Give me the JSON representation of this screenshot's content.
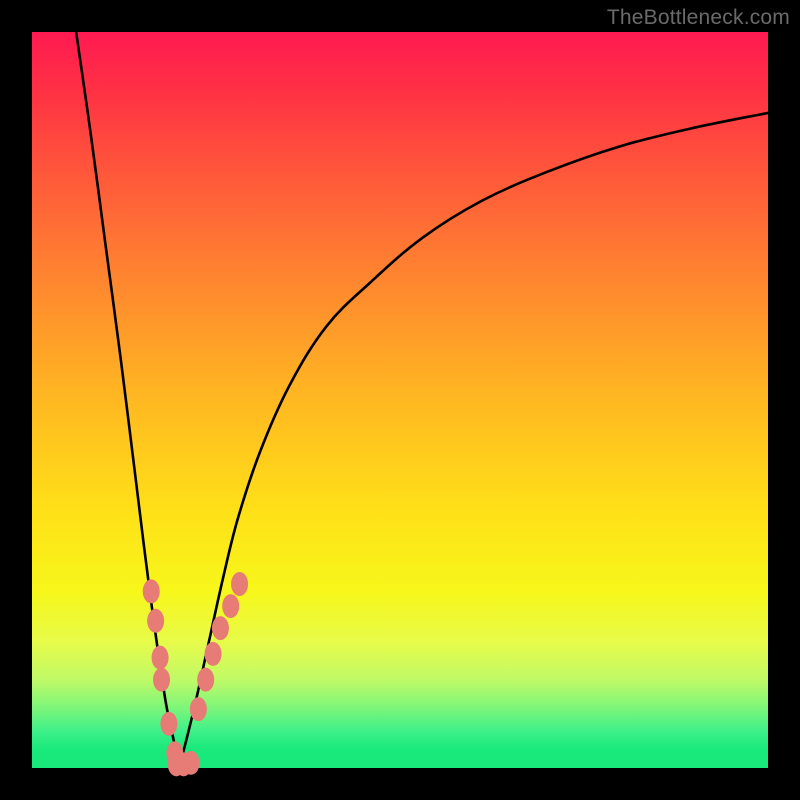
{
  "watermark": "TheBottleneck.com",
  "chart_data": {
    "type": "line",
    "title": "",
    "xlabel": "",
    "ylabel": "",
    "xlim": [
      0,
      100
    ],
    "ylim": [
      0,
      100
    ],
    "grid": false,
    "legend": false,
    "series": [
      {
        "name": "curve-left",
        "x": [
          6,
          8,
          10,
          12,
          14,
          16,
          18,
          19,
          20
        ],
        "y": [
          100,
          86,
          71,
          56,
          40,
          24,
          10,
          5,
          0
        ]
      },
      {
        "name": "curve-right",
        "x": [
          20,
          22,
          24,
          26,
          28,
          31,
          35,
          40,
          46,
          53,
          61,
          70,
          80,
          90,
          100
        ],
        "y": [
          0,
          8,
          17,
          26,
          34,
          43,
          52,
          60,
          66,
          72,
          77,
          81,
          84.5,
          87,
          89
        ]
      },
      {
        "name": "markers-left",
        "type": "scatter",
        "x": [
          16.2,
          16.8,
          17.4,
          17.6,
          18.6,
          19.4
        ],
        "y": [
          24,
          20,
          15,
          12,
          6,
          2
        ]
      },
      {
        "name": "markers-bottom",
        "type": "scatter",
        "x": [
          19.6,
          20.6,
          21.6
        ],
        "y": [
          0.5,
          0.5,
          0.7
        ]
      },
      {
        "name": "markers-right",
        "type": "scatter",
        "x": [
          22.6,
          23.6,
          24.6,
          25.6,
          27.0,
          28.2
        ],
        "y": [
          8,
          12,
          15.5,
          19,
          22,
          25
        ]
      }
    ],
    "background_gradient": {
      "top": "#ff1a51",
      "middle": "#ffe018",
      "bottom": "#18e97a"
    },
    "frame_color": "#000000",
    "curve_color": "#000000",
    "marker_color": "#e77b76"
  }
}
